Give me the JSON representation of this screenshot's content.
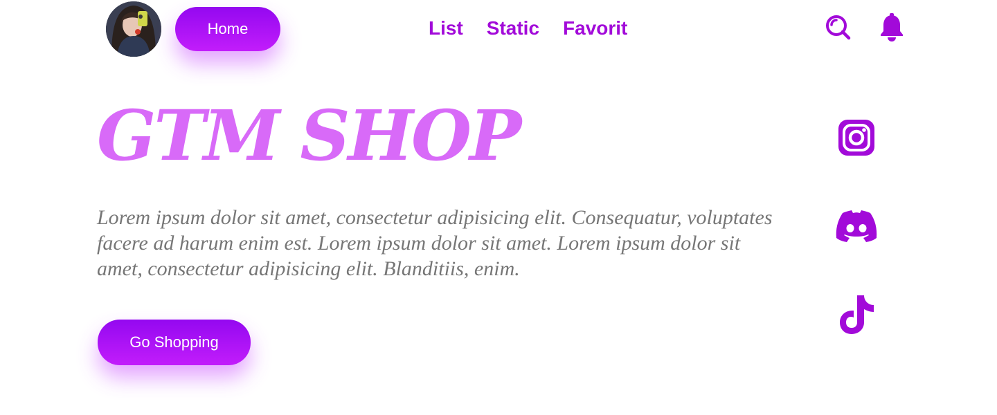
{
  "header": {
    "home_label": "Home",
    "nav": [
      {
        "label": "List"
      },
      {
        "label": "Static"
      },
      {
        "label": "Favorit"
      }
    ],
    "icons": {
      "search": "search-icon",
      "notifications": "bell-icon",
      "avatar": "user-avatar"
    }
  },
  "hero": {
    "title": "GTM SHOP",
    "text": "Lorem ipsum dolor sit amet, consectetur adipisicing elit. Consequatur, voluptates facere ad harum enim est. Lorem ipsum dolor sit amet. Lorem ipsum dolor sit amet, consectetur adipisicing elit. Blanditiis, enim.",
    "cta_label": "Go Shopping"
  },
  "socials": [
    {
      "icon": "instagram-icon"
    },
    {
      "icon": "discord-icon"
    },
    {
      "icon": "tiktok-icon"
    }
  ],
  "colors": {
    "accent": "#a20ad9",
    "title": "#d86af8",
    "button_top": "#9408f0",
    "button_bottom": "#c21dfb",
    "body_text": "#767676"
  }
}
